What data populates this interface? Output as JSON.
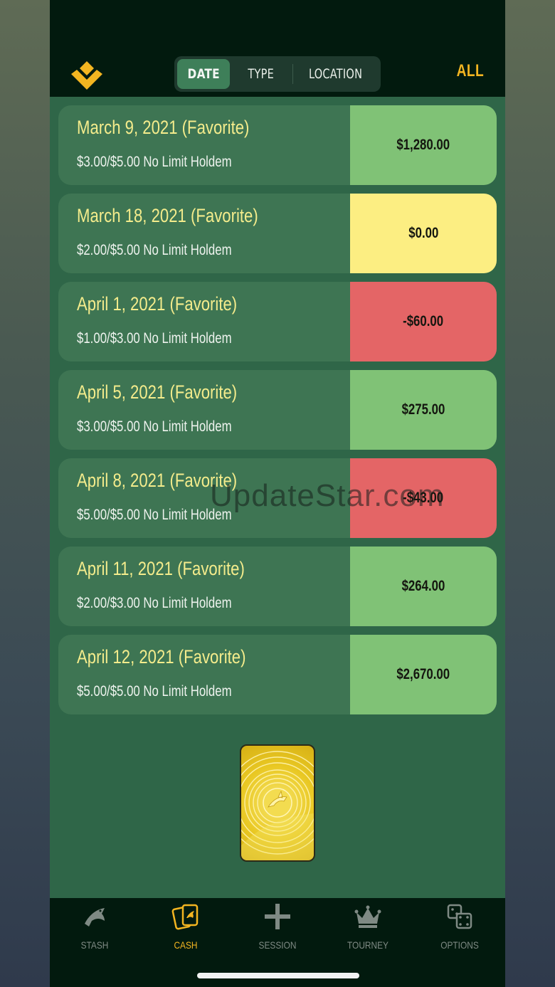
{
  "header": {
    "segments": [
      {
        "label": "DATE",
        "selected": true
      },
      {
        "label": "TYPE",
        "selected": false
      },
      {
        "label": "LOCATION",
        "selected": false
      }
    ],
    "filter_label": "ALL",
    "accent_color": "#f3b521"
  },
  "sessions": [
    {
      "title": "March 9, 2021 (Favorite)",
      "subtitle": "$3.00/$5.00 No Limit Holdem",
      "amount": "$1,280.00",
      "status": "win",
      "color": "#80c276"
    },
    {
      "title": "March 18, 2021 (Favorite)",
      "subtitle": "$2.00/$5.00 No Limit Holdem",
      "amount": "$0.00",
      "status": "even",
      "color": "#fcee82"
    },
    {
      "title": "April 1, 2021 (Favorite)",
      "subtitle": "$1.00/$3.00 No Limit Holdem",
      "amount": "-$60.00",
      "status": "loss",
      "color": "#e46566"
    },
    {
      "title": "April 5, 2021 (Favorite)",
      "subtitle": "$3.00/$5.00 No Limit Holdem",
      "amount": "$275.00",
      "status": "win",
      "color": "#80c276"
    },
    {
      "title": "April 8, 2021 (Favorite)",
      "subtitle": "$5.00/$5.00 No Limit Holdem",
      "amount": "-$43.00",
      "status": "loss",
      "color": "#e46566"
    },
    {
      "title": "April 11, 2021 (Favorite)",
      "subtitle": "$2.00/$3.00 No Limit Holdem",
      "amount": "$264.00",
      "status": "win",
      "color": "#80c276"
    },
    {
      "title": "April 12, 2021 (Favorite)",
      "subtitle": "$5.00/$5.00 No Limit Holdem",
      "amount": "$2,670.00",
      "status": "win",
      "color": "#80c276"
    }
  ],
  "watermark": "UpdateStar.com",
  "card_icon": "shark-coin-card",
  "tabs": [
    {
      "label": "STASH",
      "icon": "shark-icon",
      "active": false
    },
    {
      "label": "CASH",
      "icon": "cards-icon",
      "active": true
    },
    {
      "label": "SESSION",
      "icon": "plus-icon",
      "active": false
    },
    {
      "label": "TOURNEY",
      "icon": "crown-icon",
      "active": false
    },
    {
      "label": "OPTIONS",
      "icon": "dice-icon",
      "active": false
    }
  ]
}
